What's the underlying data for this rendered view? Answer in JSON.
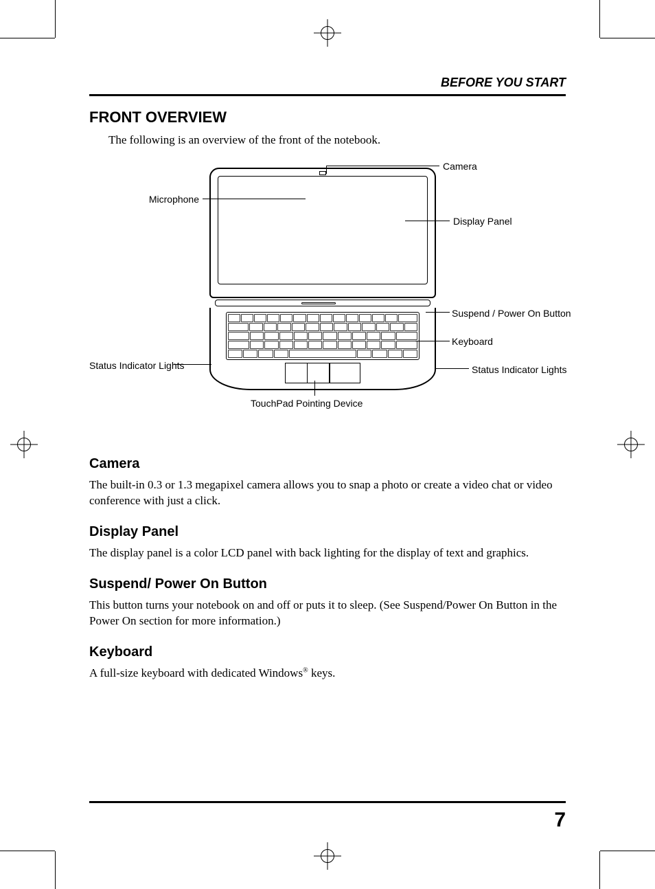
{
  "running_head": "BEFORE YOU START",
  "section_title": "FRONT OVERVIEW",
  "intro": "The following is an overview of the front of the notebook.",
  "labels": {
    "camera": "Camera",
    "microphone": "Microphone",
    "display_panel": "Display Panel",
    "suspend": "Suspend / Power On Button",
    "keyboard": "Keyboard",
    "status_left": "Status Indicator Lights",
    "status_right": "Status Indicator Lights",
    "touchpad": "TouchPad Pointing Device"
  },
  "sections": {
    "camera": {
      "h": "Camera",
      "p": "The built-in 0.3 or 1.3 megapixel camera allows you to snap a photo or create a video chat or video conference with just a click."
    },
    "display": {
      "h": "Display Panel",
      "p": "The display panel is a color LCD panel with back lighting for the display of text and graphics."
    },
    "suspend": {
      "h": "Suspend/ Power On Button",
      "p": "This button turns your notebook on and off or puts it to sleep. (See Suspend/Power On Button in the Power On section for more information.)"
    },
    "keyboard": {
      "h": "Keyboard",
      "p_pre": "A full-size keyboard with dedicated Windows",
      "p_post": " keys."
    }
  },
  "page_number": "7"
}
